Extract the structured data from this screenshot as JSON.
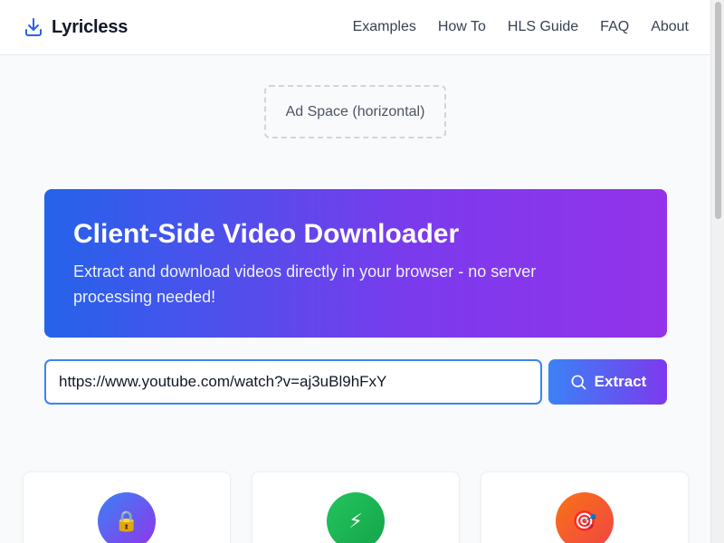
{
  "header": {
    "brand": "Lyricless",
    "nav": [
      "Examples",
      "How To",
      "HLS Guide",
      "FAQ",
      "About"
    ]
  },
  "ad": {
    "label": "Ad Space (horizontal)"
  },
  "hero": {
    "title": "Client-Side Video Downloader",
    "subtitle": "Extract and download videos directly in your browser - no server processing needed!"
  },
  "search": {
    "value": "https://www.youtube.com/watch?v=aj3uBl9hFxY",
    "button_label": "Extract"
  },
  "features": [
    {
      "icon": "lock-icon",
      "glyph": "🔒"
    },
    {
      "icon": "lightning-icon",
      "glyph": "⚡"
    },
    {
      "icon": "target-icon",
      "glyph": "🎯"
    }
  ],
  "colors": {
    "accent_blue": "#2563eb",
    "accent_purple": "#9333ea",
    "input_border": "#3b82f6"
  }
}
